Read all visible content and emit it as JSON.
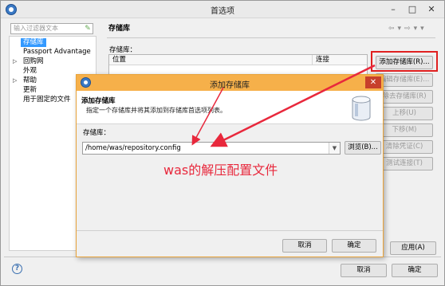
{
  "window": {
    "title": "首选项",
    "min": "–",
    "max": "□",
    "close": "✕"
  },
  "filter": {
    "placeholder": "输入过滤器文本"
  },
  "tree": {
    "items": [
      {
        "label": "存储库",
        "selected": true,
        "expandable": false
      },
      {
        "label": "Passport Advantage",
        "selected": false,
        "expandable": false
      },
      {
        "label": "回购网",
        "selected": false,
        "expandable": true
      },
      {
        "label": "外观",
        "selected": false,
        "expandable": false
      },
      {
        "label": "帮助",
        "selected": false,
        "expandable": true
      },
      {
        "label": "更新",
        "selected": false,
        "expandable": false
      },
      {
        "label": "用于固定的文件",
        "selected": false,
        "expandable": false
      }
    ]
  },
  "pane": {
    "title": "存储库",
    "list_label": "存储库：",
    "columns": [
      "位置",
      "连接"
    ],
    "buttons": {
      "add": "添加存储库(R)...",
      "edit": "编辑存储库(E)...",
      "remove": "除去存储库(R)",
      "up": "上移(U)",
      "down": "下移(M)",
      "clear": "清除凭证(C)",
      "test": "测试连接(T)"
    },
    "apply": "应用(A)"
  },
  "footer": {
    "ok": "确定",
    "cancel": "取消"
  },
  "dialog": {
    "title": "添加存储库",
    "head_title": "添加存储库",
    "head_desc": "指定一个存储库并将其添加到存储库首选项列表。",
    "repo_label": "存储库：",
    "repo_value": "/home/was/repository.config",
    "browse": "浏览(B)...",
    "cancel": "取消",
    "ok": "确定"
  },
  "annotation": {
    "text": "was的解压配置文件",
    "color": "#e8283c"
  },
  "colors": {
    "accent": "#3399ff",
    "dialog_title": "#f6b04a",
    "highlight_box": "#e02020"
  }
}
